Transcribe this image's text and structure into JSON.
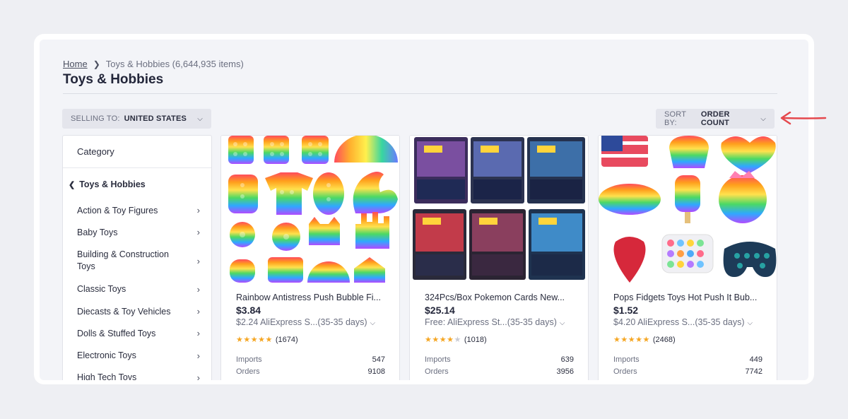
{
  "breadcrumb": {
    "home": "Home",
    "current": "Toys & Hobbies (6,644,935 items)"
  },
  "title": "Toys & Hobbies",
  "selling_to": {
    "label": "SELLING TO:",
    "value": "UNITED STATES"
  },
  "sort_by": {
    "label": "SORT BY:",
    "value": "ORDER COUNT"
  },
  "sidebar": {
    "heading": "Category",
    "current": "Toys & Hobbies",
    "items": [
      {
        "label": "Action & Toy Figures"
      },
      {
        "label": "Baby Toys"
      },
      {
        "label": "Building & Construction Toys"
      },
      {
        "label": "Classic Toys"
      },
      {
        "label": "Diecasts & Toy Vehicles"
      },
      {
        "label": "Dolls & Stuffed Toys"
      },
      {
        "label": "Electronic Toys"
      },
      {
        "label": "High Tech Toys"
      }
    ]
  },
  "products": [
    {
      "title": "Rainbow Antistress Push Bubble Fi...",
      "price": "$3.84",
      "shipping": "$2.24 AliExpress S...(35-35 days)",
      "rating_count": "(1674)",
      "stars": 5,
      "imports_label": "Imports",
      "imports": "547",
      "orders_label": "Orders",
      "orders": "9108"
    },
    {
      "title": "324Pcs/Box Pokemon Cards New...",
      "price": "$25.14",
      "shipping": "Free: AliExpress St...(35-35 days)",
      "rating_count": "(1018)",
      "stars": 4,
      "imports_label": "Imports",
      "imports": "639",
      "orders_label": "Orders",
      "orders": "3956"
    },
    {
      "title": "Pops Fidgets Toys Hot Push It Bub...",
      "price": "$1.52",
      "shipping": "$4.20 AliExpress S...(35-35 days)",
      "rating_count": "(2468)",
      "stars": 5,
      "imports_label": "Imports",
      "imports": "449",
      "orders_label": "Orders",
      "orders": "7742"
    }
  ],
  "colors": {
    "accent_arrow": "#e5484d",
    "star": "#f5a623"
  }
}
